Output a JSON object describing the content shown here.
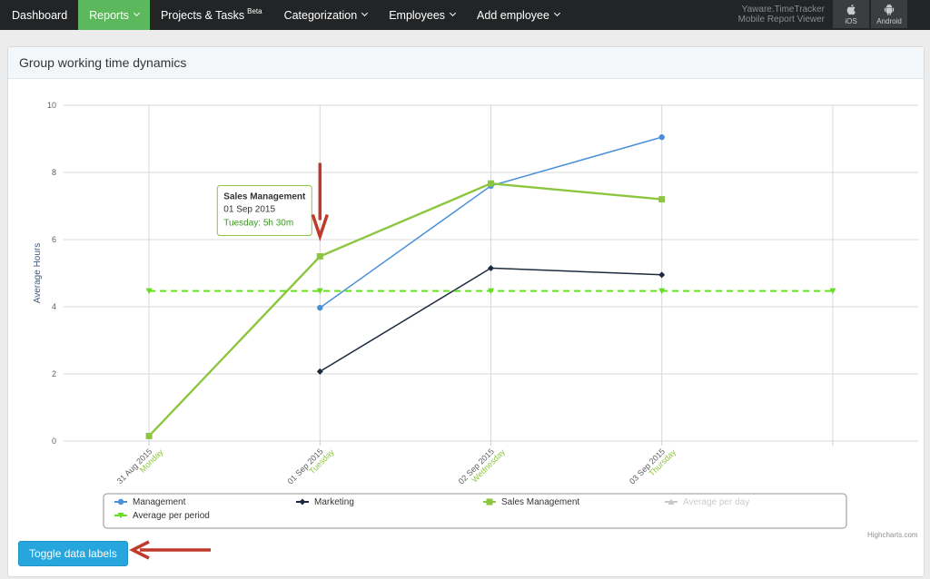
{
  "nav": {
    "items": [
      {
        "label": "Dashboard"
      },
      {
        "label": "Reports",
        "active": true
      },
      {
        "label": "Projects & Tasks",
        "badge": "Beta"
      },
      {
        "label": "Categorization"
      },
      {
        "label": "Employees"
      },
      {
        "label": "Add employee"
      }
    ],
    "mobile_line1": "Yaware.TimeTracker",
    "mobile_line2": "Mobile Report Viewer",
    "ios_label": "iOS",
    "android_label": "Android"
  },
  "panel": {
    "title": "Group working time dynamics",
    "toggle_label": "Toggle data labels",
    "credits": "Highcharts.com"
  },
  "colors": {
    "management": "#4a90d9",
    "marketing": "#1d2a3e",
    "sales": "#8cc63f",
    "average_period": "#66dd22",
    "average_day": "#c8c8c8",
    "annotation_arrow": "#c0392b",
    "active_nav": "#5cb85c",
    "button": "#27a6dd"
  },
  "chart_data": {
    "type": "line",
    "ylabel": "Average Hours",
    "ylim": [
      0,
      10
    ],
    "yticks": [
      0,
      2,
      4,
      6,
      8,
      10
    ],
    "categories": [
      {
        "date": "31 Aug 2015",
        "day": "Monday"
      },
      {
        "date": "01 Sep 2015",
        "day": "Tuesday"
      },
      {
        "date": "02 Sep 2015",
        "day": "Wednesday"
      },
      {
        "date": "03 Sep 2015",
        "day": "Thursday"
      },
      {
        "date": "",
        "day": ""
      }
    ],
    "series": [
      {
        "name": "Management",
        "key": "management",
        "marker": "circle",
        "values": [
          null,
          3.97,
          7.6,
          9.05,
          null
        ]
      },
      {
        "name": "Marketing",
        "key": "marketing",
        "marker": "diamond",
        "values": [
          null,
          2.07,
          5.15,
          4.95,
          null
        ]
      },
      {
        "name": "Sales Management",
        "key": "sales",
        "marker": "square",
        "values": [
          0.15,
          5.5,
          7.67,
          7.2,
          null
        ]
      },
      {
        "name": "Average per day",
        "key": "average_day",
        "marker": "triangle",
        "disabled": true,
        "values": []
      },
      {
        "name": "Average per period",
        "key": "average_period",
        "marker": "triangle-down",
        "dashed": true,
        "values": [
          4.47,
          4.47,
          4.47,
          4.47,
          4.47
        ]
      }
    ],
    "tooltip": {
      "series": "Sales Management",
      "date": "01 Sep 2015",
      "value_text": "Tuesday: 5h 30m"
    },
    "grid": true,
    "legend": "bottom"
  }
}
